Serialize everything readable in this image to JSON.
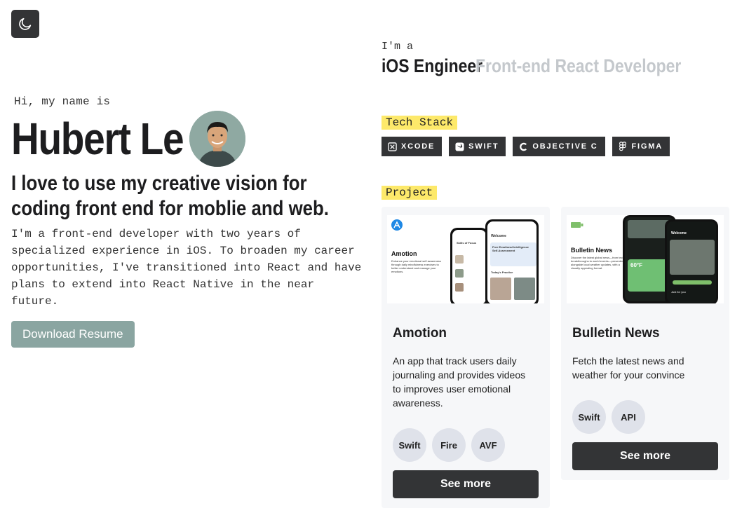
{
  "theme_toggle": {
    "icon": "moon-icon"
  },
  "hero": {
    "greeting": "Hi, my name is",
    "name": "Hubert Le",
    "tagline": "I love to use my creative vision for coding front end for moblie and web.",
    "bio": "I'm a front-end developer with two years of specialized experience in iOS. To broaden my career opportunities, I've transitioned into React and have plans to extend into React Native in the near future.",
    "resume_button": "Download Resume"
  },
  "roles": {
    "prefix": "I'm a",
    "primary": "iOS Engineer",
    "secondary": "Front-end React Developer"
  },
  "tech_stack": {
    "label": "Tech Stack",
    "items": [
      {
        "label": "XCODE",
        "icon": "xcode-icon"
      },
      {
        "label": "SWIFT",
        "icon": "swift-icon"
      },
      {
        "label": "OBJECTIVE C",
        "icon": "objective-c-icon"
      },
      {
        "label": "FIGMA",
        "icon": "figma-icon"
      }
    ]
  },
  "projects": {
    "label": "Project",
    "items": [
      {
        "title": "Amotion",
        "description": "An app that track users daily journaling and provides videos to improves user emotional awareness.",
        "tags": [
          "Swift",
          "Fire",
          "AVF"
        ],
        "button": "See more",
        "preview": {
          "app_name": "Amotion",
          "blurb": "Enhance your emotional self awareness through daily mindfulness exercises to better understand and manage your emotions.",
          "screen_1_title": "Skills of Focus",
          "screen_2_title": "Welcome",
          "screen_2_card": "Free Emotional Intelligence Self-Assessment",
          "screen_2_section": "Today's Practice"
        }
      },
      {
        "title": "Bulletin News",
        "description": "Fetch the latest news and weather for your convince",
        "tags": [
          "Swift",
          "API"
        ],
        "button": "See more",
        "preview": {
          "app_name": "Bulletin News",
          "blurb": "Discover the latest global news—from tech breakthroughs to world events—presented alongside local weather updates, with a visually appealing format.",
          "temp": "60°F",
          "screen_2_title": "Welcome",
          "screen_2_section": "Just for you"
        }
      }
    ]
  },
  "colors": {
    "dark": "#333436",
    "accent": "#8aa5a1",
    "highlight": "#fde96a",
    "muted_role": "#c4c8cc",
    "tag_bg": "#dfe2ea",
    "card_bg": "#f6f7f9"
  }
}
